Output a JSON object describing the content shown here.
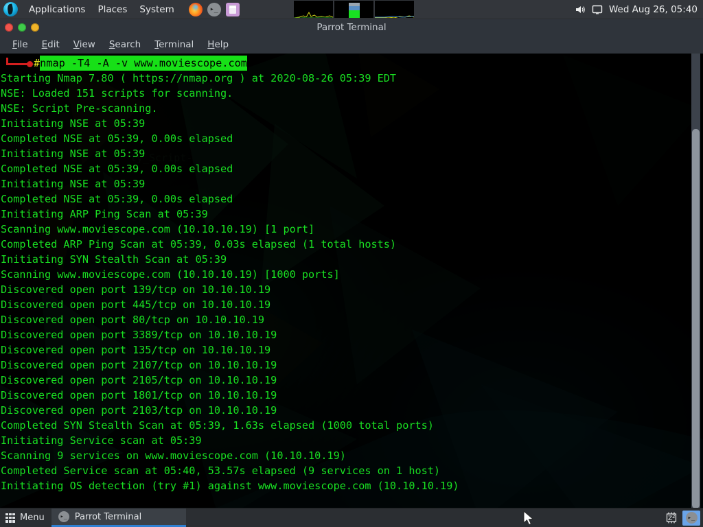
{
  "top_panel": {
    "logo_icon": "parrot-logo-icon",
    "menus": [
      "Applications",
      "Places",
      "System"
    ],
    "launchers": [
      {
        "name": "firefox-icon",
        "label": "Firefox"
      },
      {
        "name": "terminal-icon",
        "label": ">_"
      },
      {
        "name": "files-icon",
        "label": "Files"
      }
    ],
    "monitors": [
      "cpu-graph",
      "memory-graph",
      "network-graph"
    ],
    "volume_icon": "speaker-icon",
    "display_icon": "display-icon",
    "clock": "Wed Aug 26, 05:40"
  },
  "window": {
    "title": "Parrot Terminal",
    "buttons": {
      "close": "close-button",
      "minimize": "minimize-button",
      "maximize": "maximize-button"
    },
    "menubar": [
      {
        "mnemonic": "F",
        "rest": "ile"
      },
      {
        "mnemonic": "E",
        "rest": "dit"
      },
      {
        "mnemonic": "V",
        "rest": "iew"
      },
      {
        "mnemonic": "S",
        "rest": "earch"
      },
      {
        "mnemonic": "T",
        "rest": "erminal"
      },
      {
        "mnemonic": "H",
        "rest": "elp"
      }
    ]
  },
  "terminal": {
    "prompt_symbol": "#",
    "command": "nmap -T4 -A -v www.moviescope.com",
    "command_bg": "#17e017",
    "command_fg": "#000000",
    "prompt_symbol_color": "#e8e820",
    "text_color": "#19e022",
    "lines": [
      "Starting Nmap 7.80 ( https://nmap.org ) at 2020-08-26 05:39 EDT",
      "NSE: Loaded 151 scripts for scanning.",
      "NSE: Script Pre-scanning.",
      "Initiating NSE at 05:39",
      "Completed NSE at 05:39, 0.00s elapsed",
      "Initiating NSE at 05:39",
      "Completed NSE at 05:39, 0.00s elapsed",
      "Initiating NSE at 05:39",
      "Completed NSE at 05:39, 0.00s elapsed",
      "Initiating ARP Ping Scan at 05:39",
      "Scanning www.moviescope.com (10.10.10.19) [1 port]",
      "Completed ARP Ping Scan at 05:39, 0.03s elapsed (1 total hosts)",
      "Initiating SYN Stealth Scan at 05:39",
      "Scanning www.moviescope.com (10.10.10.19) [1000 ports]",
      "Discovered open port 139/tcp on 10.10.10.19",
      "Discovered open port 445/tcp on 10.10.10.19",
      "Discovered open port 80/tcp on 10.10.10.19",
      "Discovered open port 3389/tcp on 10.10.10.19",
      "Discovered open port 135/tcp on 10.10.10.19",
      "Discovered open port 2107/tcp on 10.10.10.19",
      "Discovered open port 2105/tcp on 10.10.10.19",
      "Discovered open port 1801/tcp on 10.10.10.19",
      "Discovered open port 2103/tcp on 10.10.10.19",
      "Completed SYN Stealth Scan at 05:39, 1.63s elapsed (1000 total ports)",
      "Initiating Service scan at 05:39",
      "Scanning 9 services on www.moviescope.com (10.10.10.19)",
      "Completed Service scan at 05:40, 53.57s elapsed (9 services on 1 host)",
      "Initiating OS detection (try #1) against www.moviescope.com (10.10.10.19)"
    ]
  },
  "taskbar": {
    "menu_label": "Menu",
    "menu_icon": "grid-icon",
    "task": {
      "label": "Parrot Terminal",
      "icon": "terminal-icon"
    },
    "tray": [
      {
        "name": "sleep-icon",
        "label": "1Z²"
      },
      {
        "name": "terminal-tray-icon",
        "label": ">_"
      }
    ]
  }
}
